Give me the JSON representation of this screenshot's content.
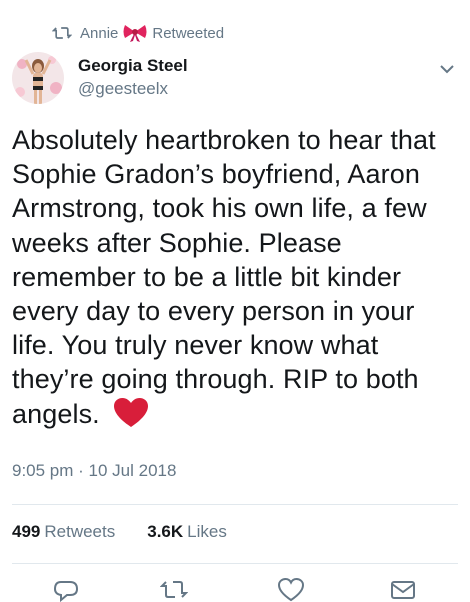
{
  "retweet": {
    "user": "Annie",
    "label": "Retweeted"
  },
  "author": {
    "name": "Georgia Steel",
    "handle": "@geesteelx"
  },
  "tweet": {
    "text": "Absolutely heartbroken to hear that Sophie Gradon’s boyfriend, Aaron Armstrong, took his own life, a few weeks after Sophie. Please remember to be a little bit kinder every day to every person in your life. You truly never know what they’re going through. RIP to both angels.",
    "time": "9:05 pm · 10 Jul 2018"
  },
  "stats": {
    "retweets_count": "499",
    "retweets_label": "Retweets",
    "likes_count": "3.6K",
    "likes_label": "Likes"
  },
  "colors": {
    "text": "#14171a",
    "secondary": "#657786",
    "heart": "#e0245e",
    "divider": "#e1e8ed"
  },
  "icons": [
    "retweet-icon",
    "bow-emoji-icon",
    "avatar",
    "chevron-down-icon",
    "red-heart-emoji-icon",
    "reply-icon",
    "like-icon",
    "message-icon"
  ]
}
